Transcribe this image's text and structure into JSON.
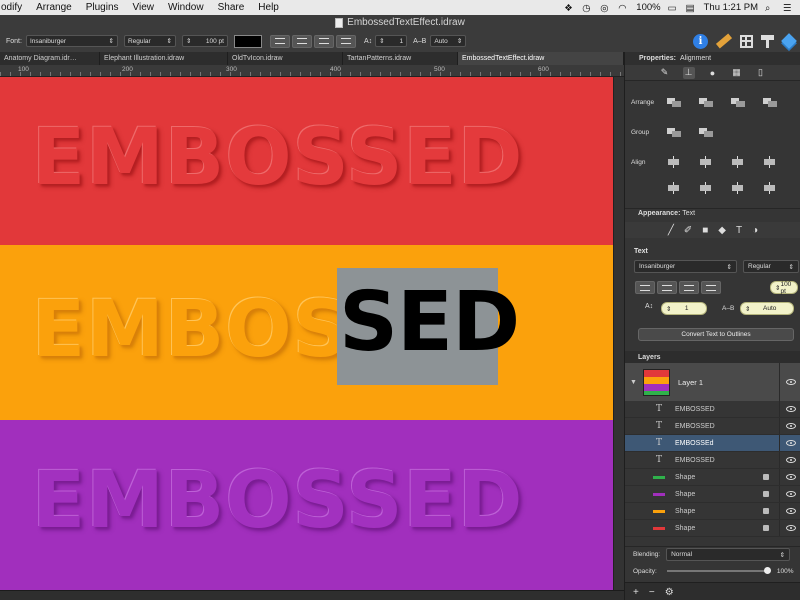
{
  "menubar": {
    "items": [
      "odify",
      "Arrange",
      "Plugins",
      "View",
      "Window",
      "Share",
      "Help"
    ],
    "battery": "100%",
    "clock": "Thu 1:21 PM"
  },
  "window": {
    "title": "EmbossedTextEffect.idraw"
  },
  "toolbar": {
    "font_label": "Font:",
    "font_value": "Insaniburger",
    "style_value": "Regular",
    "size_value": "100 pt",
    "spacing_value": "1",
    "kern_label": "A–B",
    "kern_value": "Auto"
  },
  "tabs": [
    {
      "label": "Anatomy Diagram.idr…"
    },
    {
      "label": "Elephant Illustration.idraw"
    },
    {
      "label": "OldTvIcon.idraw"
    },
    {
      "label": "TartanPatterns.idraw"
    },
    {
      "label": "EmbossedTextEffect.idraw"
    }
  ],
  "ruler": {
    "labels": [
      "100",
      "200",
      "300",
      "400",
      "500",
      "600"
    ]
  },
  "canvas": {
    "band_text": "EMBOSSED",
    "orange_text_left": "EMBOS",
    "selected_text": "SED",
    "colors": {
      "red": "#e2383a",
      "orange": "#fba10c",
      "purple": "#a12fbd",
      "selection": "#8d9396"
    }
  },
  "panel": {
    "properties_label": "Properties:",
    "properties_value": "Alignment",
    "arrange_label": "Arrange",
    "group_label": "Group",
    "align_label": "Align",
    "appearance_label": "Appearance:",
    "appearance_value": "Text",
    "text_section": "Text",
    "font_value": "Insaniburger",
    "style_value": "Regular",
    "size_value": "100 pt",
    "spacing_value": "1",
    "kern_label": "A–B",
    "kern_value": "Auto",
    "convert_label": "Convert Text to Outlines",
    "layers_title": "Layers",
    "layer_name": "Layer 1",
    "layer_items": [
      {
        "type": "text",
        "name": "EMBOSSED"
      },
      {
        "type": "text",
        "name": "EMBOSSED"
      },
      {
        "type": "text",
        "name": "EMBOSSEd"
      },
      {
        "type": "text",
        "name": "EMBOSSED"
      },
      {
        "type": "shape",
        "name": "Shape",
        "color": "#2fb14b"
      },
      {
        "type": "shape",
        "name": "Shape",
        "color": "#a12fbd"
      },
      {
        "type": "shape",
        "name": "Shape",
        "color": "#fba10c"
      },
      {
        "type": "shape",
        "name": "Shape",
        "color": "#e2383a"
      }
    ],
    "blending_label": "Blending:",
    "blending_value": "Normal",
    "opacity_label": "Opacity:",
    "opacity_value": "100%"
  }
}
